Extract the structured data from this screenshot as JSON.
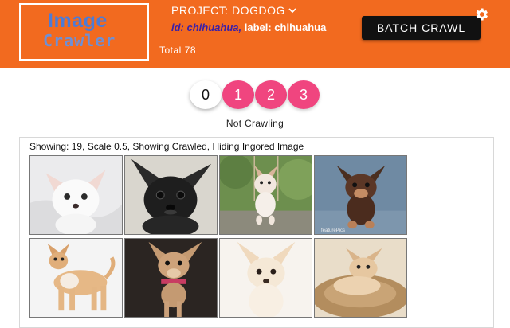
{
  "header": {
    "logo": {
      "line1": "Image",
      "line2": "Crawler"
    },
    "total_label": "Total 78",
    "project_label": "PROJECT: DOGDOG",
    "id_text": "id: chihuahua,",
    "label_text": " label: chihuahua",
    "batch_button": "BATCH CRAWL",
    "icons": {
      "dropdown": "chevron-down-icon",
      "settings": "gear-icon"
    },
    "colors": {
      "header_bg": "#f26a1f",
      "id_text": "#3a1fa8",
      "button_bg": "#111111"
    }
  },
  "pager": {
    "pages": [
      "0",
      "1",
      "2",
      "3"
    ],
    "active_index": 0,
    "colors": {
      "page": "#f0457f",
      "active": "#ffffff"
    }
  },
  "status_text": "Not Crawling",
  "panel": {
    "showing_text": "Showing: 19,  Scale 0.5, Showing Crawled, Hiding Ingored Image",
    "images": [
      {
        "name": "white-chihuahua-on-blanket"
      },
      {
        "name": "black-chihuahua-closeup"
      },
      {
        "name": "puppy-on-swing"
      },
      {
        "name": "chihuahua-with-watermark",
        "watermark": "featurePics"
      },
      {
        "name": "fawn-chihuahua-standing"
      },
      {
        "name": "chihuahua-with-collar"
      },
      {
        "name": "cream-chihuahua-portrait"
      },
      {
        "name": "chihuahua-lying-on-pillow"
      }
    ]
  }
}
